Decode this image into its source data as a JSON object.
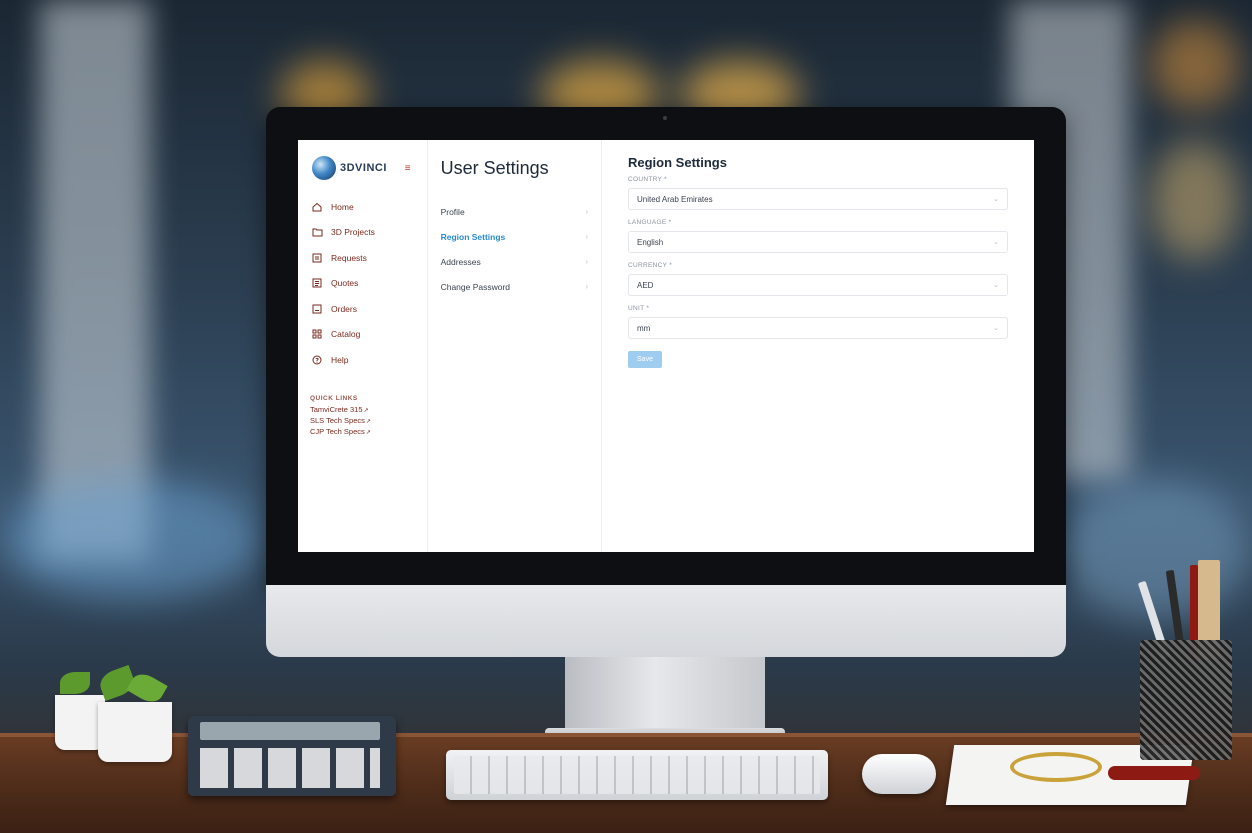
{
  "sidebar": {
    "logo_text": "3DVINCI",
    "nav": [
      {
        "label": "Home",
        "icon": "home-icon"
      },
      {
        "label": "3D Projects",
        "icon": "folder-icon"
      },
      {
        "label": "Requests",
        "icon": "document-icon"
      },
      {
        "label": "Quotes",
        "icon": "quote-icon"
      },
      {
        "label": "Orders",
        "icon": "order-icon"
      },
      {
        "label": "Catalog",
        "icon": "grid-icon"
      },
      {
        "label": "Help",
        "icon": "help-icon"
      }
    ],
    "quick_links": {
      "title": "QUICK LINKS",
      "items": [
        "TamviCrete 315",
        "SLS Tech Specs",
        "CJP Tech Specs"
      ]
    }
  },
  "settings": {
    "title": "User Settings",
    "items": [
      {
        "label": "Profile"
      },
      {
        "label": "Region Settings",
        "active": true
      },
      {
        "label": "Addresses"
      },
      {
        "label": "Change Password"
      }
    ]
  },
  "region": {
    "title": "Region Settings",
    "fields": [
      {
        "label": "COUNTRY *",
        "value": "United Arab Emirates"
      },
      {
        "label": "LANGUAGE *",
        "value": "English"
      },
      {
        "label": "CURRENCY *",
        "value": "AED"
      },
      {
        "label": "UNIT *",
        "value": "mm"
      }
    ],
    "save_label": "Save"
  },
  "colors": {
    "accent": "#2a8bd0",
    "nav_text": "#7a2a1f",
    "save_button": "#9fcdef"
  }
}
